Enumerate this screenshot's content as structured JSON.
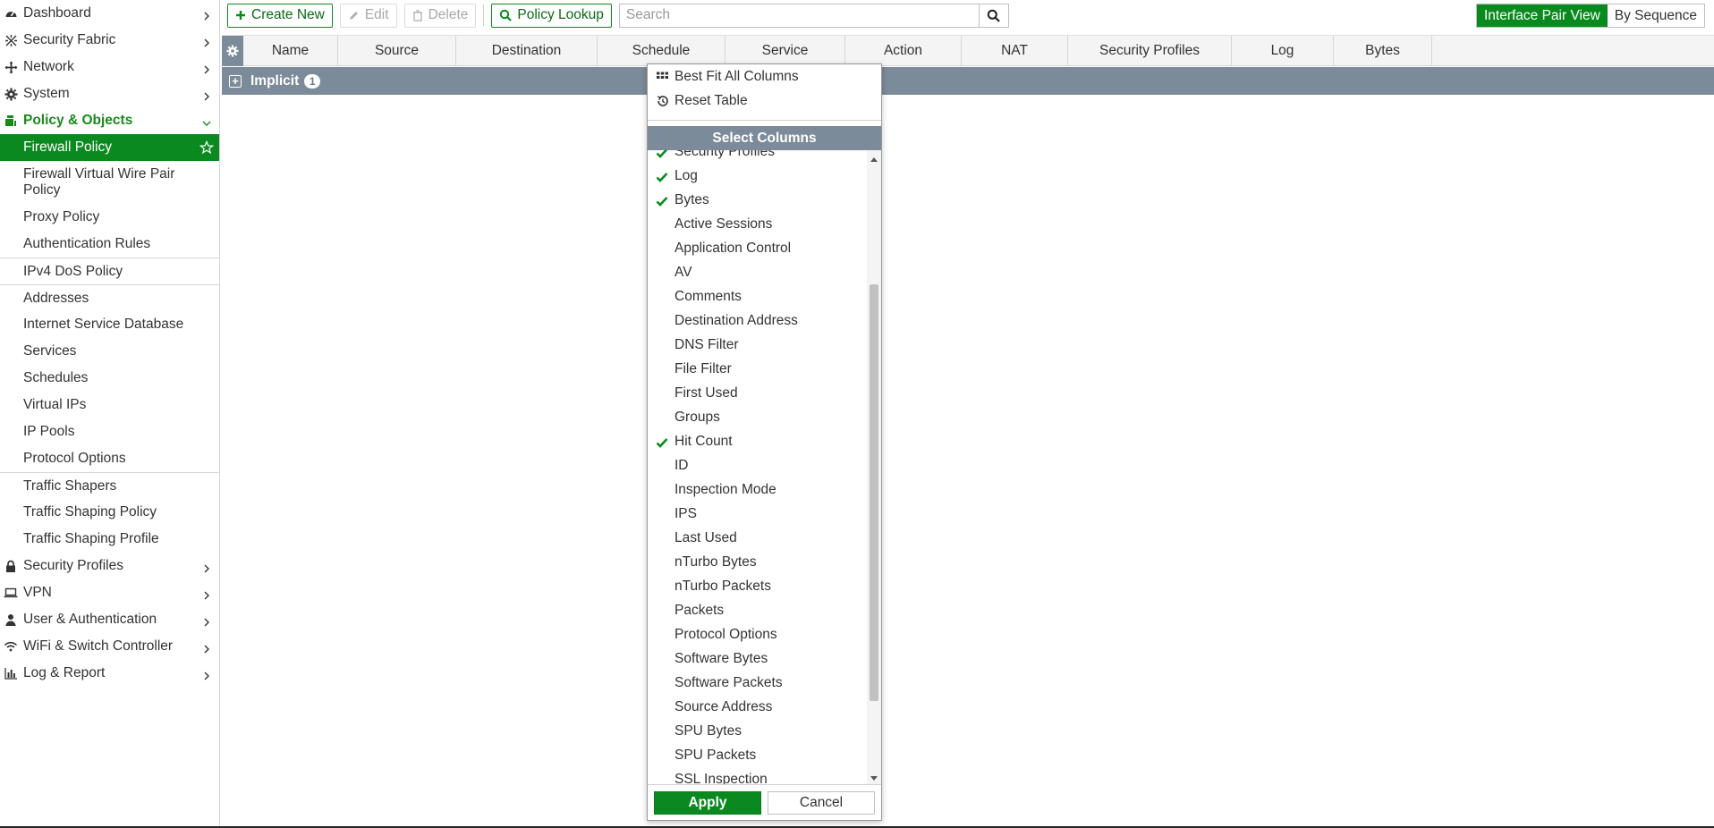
{
  "sidebar": {
    "top_items_1": [
      {
        "label": "Dashboard",
        "icon": "dashboard-icon"
      },
      {
        "label": "Security Fabric",
        "icon": "security-fabric-icon"
      },
      {
        "label": "Network",
        "icon": "network-icon"
      },
      {
        "label": "System",
        "icon": "system-gear-icon"
      }
    ],
    "policy_section": {
      "label": "Policy & Objects",
      "icon": "policy-objects-icon"
    },
    "policy_items": {
      "firewall_policy": "Firewall Policy",
      "virtual_wire": "Firewall Virtual Wire Pair Policy",
      "proxy_policy": "Proxy Policy",
      "auth_rules": "Authentication Rules",
      "dos_policy": "IPv4 DoS Policy",
      "addresses": "Addresses",
      "isdb": "Internet Service Database",
      "services": "Services",
      "schedules": "Schedules",
      "virtual_ips": "Virtual IPs",
      "ip_pools": "IP Pools",
      "protocol_options": "Protocol Options",
      "traffic_shapers": "Traffic Shapers",
      "traffic_shaping_policy": "Traffic Shaping Policy",
      "traffic_shaping_profile": "Traffic Shaping Profile"
    },
    "top_items_2": [
      {
        "label": "Security Profiles",
        "icon": "lock-icon"
      },
      {
        "label": "VPN",
        "icon": "laptop-icon"
      },
      {
        "label": "User & Authentication",
        "icon": "user-icon"
      },
      {
        "label": "WiFi & Switch Controller",
        "icon": "wifi-icon"
      },
      {
        "label": "Log & Report",
        "icon": "bar-chart-icon"
      }
    ]
  },
  "toolbar": {
    "create_new": "Create New",
    "edit": "Edit",
    "delete": "Delete",
    "policy_lookup": "Policy Lookup",
    "search_placeholder": "Search",
    "interface_pair_view": "Interface Pair View",
    "by_sequence": "By Sequence"
  },
  "table": {
    "columns": [
      "Name",
      "Source",
      "Destination",
      "Schedule",
      "Service",
      "Action",
      "NAT",
      "Security Profiles",
      "Log",
      "Bytes"
    ],
    "group_row": {
      "label": "Implicit",
      "count": "1"
    }
  },
  "dropdown": {
    "best_fit": "Best Fit All Columns",
    "reset_table": "Reset Table",
    "title": "Select Columns",
    "items": [
      {
        "label": "Security Profiles",
        "checked": true
      },
      {
        "label": "Log",
        "checked": true
      },
      {
        "label": "Bytes",
        "checked": true
      },
      {
        "label": "Active Sessions",
        "checked": false
      },
      {
        "label": "Application Control",
        "checked": false
      },
      {
        "label": "AV",
        "checked": false
      },
      {
        "label": "Comments",
        "checked": false
      },
      {
        "label": "Destination Address",
        "checked": false
      },
      {
        "label": "DNS Filter",
        "checked": false
      },
      {
        "label": "File Filter",
        "checked": false
      },
      {
        "label": "First Used",
        "checked": false
      },
      {
        "label": "Groups",
        "checked": false
      },
      {
        "label": "Hit Count",
        "checked": true
      },
      {
        "label": "ID",
        "checked": false
      },
      {
        "label": "Inspection Mode",
        "checked": false
      },
      {
        "label": "IPS",
        "checked": false
      },
      {
        "label": "Last Used",
        "checked": false
      },
      {
        "label": "nTurbo Bytes",
        "checked": false
      },
      {
        "label": "nTurbo Packets",
        "checked": false
      },
      {
        "label": "Packets",
        "checked": false
      },
      {
        "label": "Protocol Options",
        "checked": false
      },
      {
        "label": "Software Bytes",
        "checked": false
      },
      {
        "label": "Software Packets",
        "checked": false
      },
      {
        "label": "Source Address",
        "checked": false
      },
      {
        "label": "SPU Bytes",
        "checked": false
      },
      {
        "label": "SPU Packets",
        "checked": false
      },
      {
        "label": "SSL Inspection",
        "checked": false
      }
    ],
    "apply": "Apply",
    "cancel": "Cancel"
  },
  "colors": {
    "accent_green": "#0a8a1e",
    "header_gray": "#7c8b99"
  }
}
